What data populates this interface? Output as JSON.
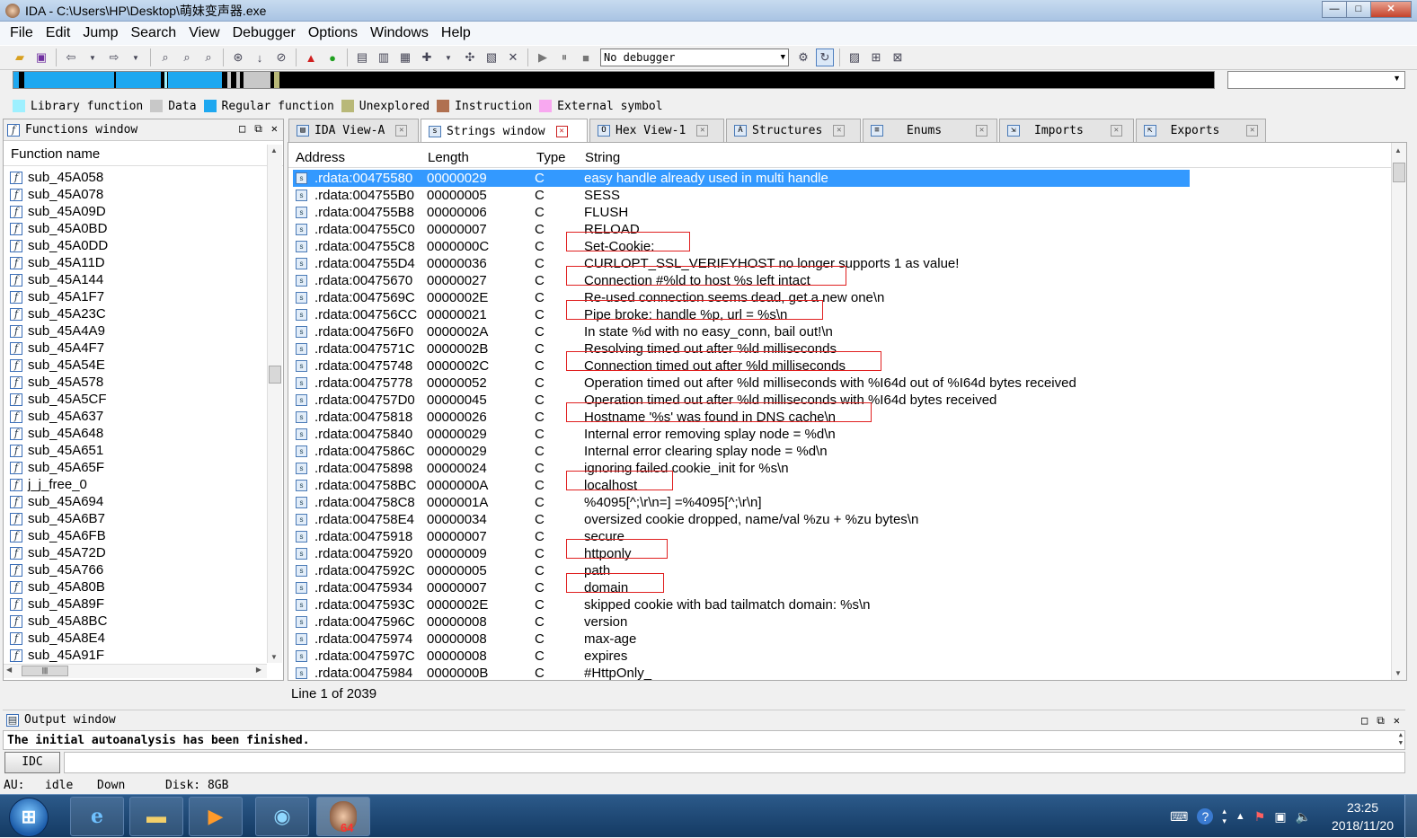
{
  "window": {
    "title": "IDA - C:\\Users\\HP\\Desktop\\萌妹变声器.exe",
    "buttons": {
      "minimize": "—",
      "maximize": "□",
      "close": "✕"
    }
  },
  "menu": [
    "File",
    "Edit",
    "Jump",
    "Search",
    "View",
    "Debugger",
    "Options",
    "Windows",
    "Help"
  ],
  "toolbar": {
    "debugger_select": "No debugger"
  },
  "legend": [
    {
      "label": "Library function",
      "color": "#9ef0ff"
    },
    {
      "label": "Data",
      "color": "#c8c8c8"
    },
    {
      "label": "Regular function",
      "color": "#1ea8f0"
    },
    {
      "label": "Unexplored",
      "color": "#b8b878"
    },
    {
      "label": "Instruction",
      "color": "#b07050"
    },
    {
      "label": "External symbol",
      "color": "#f8a8f0"
    }
  ],
  "functions_window": {
    "title": "Functions window",
    "column": "Function name",
    "items": [
      "sub_45A058",
      "sub_45A078",
      "sub_45A09D",
      "sub_45A0BD",
      "sub_45A0DD",
      "sub_45A11D",
      "sub_45A144",
      "sub_45A1F7",
      "sub_45A23C",
      "sub_45A4A9",
      "sub_45A4F7",
      "sub_45A54E",
      "sub_45A578",
      "sub_45A5CF",
      "sub_45A637",
      "sub_45A648",
      "sub_45A651",
      "sub_45A65F",
      "j_j_free_0",
      "sub_45A694",
      "sub_45A6B7",
      "sub_45A6FB",
      "sub_45A72D",
      "sub_45A766",
      "sub_45A80B",
      "sub_45A89F",
      "sub_45A8BC",
      "sub_45A8E4",
      "sub_45A91F"
    ]
  },
  "tabs": [
    {
      "label": "IDA View-A",
      "active": false
    },
    {
      "label": "Strings window",
      "active": true
    },
    {
      "label": "Hex View-1",
      "active": false
    },
    {
      "label": "Structures",
      "active": false
    },
    {
      "label": "Enums",
      "active": false
    },
    {
      "label": "Imports",
      "active": false
    },
    {
      "label": "Exports",
      "active": false
    }
  ],
  "strings_window": {
    "columns": {
      "address": "Address",
      "length": "Length",
      "type": "Type",
      "string": "String"
    },
    "rows": [
      {
        "address": ".rdata:00475580",
        "length": "00000029",
        "type": "C",
        "string": "easy handle already used in multi handle",
        "selected": true
      },
      {
        "address": ".rdata:004755B0",
        "length": "00000005",
        "type": "C",
        "string": "SESS"
      },
      {
        "address": ".rdata:004755B8",
        "length": "00000006",
        "type": "C",
        "string": "FLUSH"
      },
      {
        "address": ".rdata:004755C0",
        "length": "00000007",
        "type": "C",
        "string": "RELOAD"
      },
      {
        "address": ".rdata:004755C8",
        "length": "0000000C",
        "type": "C",
        "string": "Set-Cookie:",
        "boxed": true
      },
      {
        "address": ".rdata:004755D4",
        "length": "00000036",
        "type": "C",
        "string": "CURLOPT_SSL_VERIFYHOST no longer supports 1 as value!"
      },
      {
        "address": ".rdata:00475670",
        "length": "00000027",
        "type": "C",
        "string": "Connection #%ld to host %s left intact",
        "boxed": true
      },
      {
        "address": ".rdata:0047569C",
        "length": "0000002E",
        "type": "C",
        "string": "Re-used connection seems dead, get a new one\\n"
      },
      {
        "address": ".rdata:004756CC",
        "length": "00000021",
        "type": "C",
        "string": "Pipe broke: handle %p, url = %s\\n",
        "boxed": true
      },
      {
        "address": ".rdata:004756F0",
        "length": "0000002A",
        "type": "C",
        "string": "In state %d with no easy_conn, bail out!\\n"
      },
      {
        "address": ".rdata:0047571C",
        "length": "0000002B",
        "type": "C",
        "string": "Resolving timed out after %ld milliseconds"
      },
      {
        "address": ".rdata:00475748",
        "length": "0000002C",
        "type": "C",
        "string": "Connection timed out after %ld milliseconds",
        "boxed": true
      },
      {
        "address": ".rdata:00475778",
        "length": "00000052",
        "type": "C",
        "string": "Operation timed out after %ld milliseconds with %I64d out of %I64d bytes received"
      },
      {
        "address": ".rdata:004757D0",
        "length": "00000045",
        "type": "C",
        "string": "Operation timed out after %ld milliseconds with %I64d bytes received"
      },
      {
        "address": ".rdata:00475818",
        "length": "00000026",
        "type": "C",
        "string": "Hostname '%s' was found in DNS cache\\n",
        "boxed": true
      },
      {
        "address": ".rdata:00475840",
        "length": "00000029",
        "type": "C",
        "string": "Internal error removing splay node = %d\\n"
      },
      {
        "address": ".rdata:0047586C",
        "length": "00000029",
        "type": "C",
        "string": "Internal error clearing splay node = %d\\n"
      },
      {
        "address": ".rdata:00475898",
        "length": "00000024",
        "type": "C",
        "string": "ignoring failed cookie_init for %s\\n"
      },
      {
        "address": ".rdata:004758BC",
        "length": "0000000A",
        "type": "C",
        "string": "localhost",
        "boxed": true
      },
      {
        "address": ".rdata:004758C8",
        "length": "0000001A",
        "type": "C",
        "string": "%4095[^;\\r\\n=] =%4095[^;\\r\\n]"
      },
      {
        "address": ".rdata:004758E4",
        "length": "00000034",
        "type": "C",
        "string": "oversized cookie dropped, name/val %zu + %zu bytes\\n"
      },
      {
        "address": ".rdata:00475918",
        "length": "00000007",
        "type": "C",
        "string": "secure"
      },
      {
        "address": ".rdata:00475920",
        "length": "00000009",
        "type": "C",
        "string": "httponly",
        "boxed": true
      },
      {
        "address": ".rdata:0047592C",
        "length": "00000005",
        "type": "C",
        "string": "path"
      },
      {
        "address": ".rdata:00475934",
        "length": "00000007",
        "type": "C",
        "string": "domain",
        "boxed": true
      },
      {
        "address": ".rdata:0047593C",
        "length": "0000002E",
        "type": "C",
        "string": "skipped cookie with bad tailmatch domain: %s\\n"
      },
      {
        "address": ".rdata:0047596C",
        "length": "00000008",
        "type": "C",
        "string": "version"
      },
      {
        "address": ".rdata:00475974",
        "length": "00000008",
        "type": "C",
        "string": "max-age"
      },
      {
        "address": ".rdata:0047597C",
        "length": "00000008",
        "type": "C",
        "string": "expires"
      },
      {
        "address": ".rdata:00475984",
        "length": "0000000B",
        "type": "C",
        "string": "#HttpOnly_"
      }
    ],
    "status": "Line 1 of 2039"
  },
  "output_window": {
    "title": "Output window",
    "message": "The initial autoanalysis has been finished.",
    "idc_button": "IDC"
  },
  "statusbar": {
    "au_label": "AU:",
    "au_value": "idle",
    "direction": "Down",
    "disk": "Disk: 8GB"
  },
  "taskbar": {
    "time": "23:25",
    "date": "2018/11/20",
    "badge": "64"
  }
}
